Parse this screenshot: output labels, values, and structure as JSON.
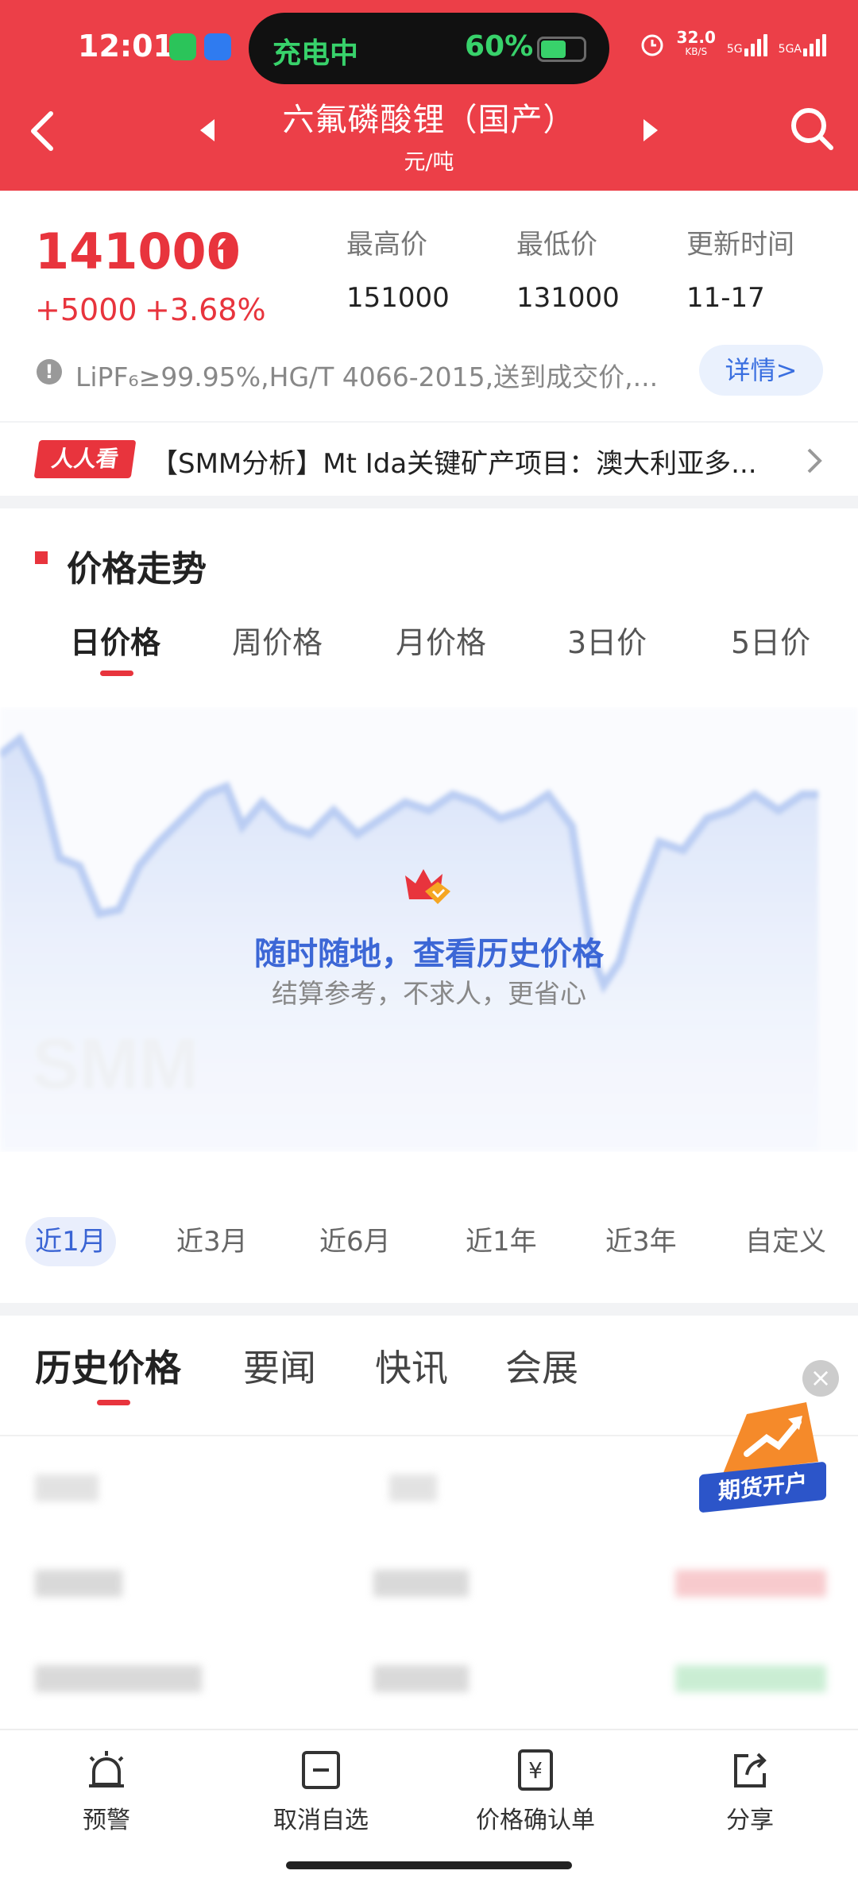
{
  "status_bar": {
    "time": "12:01",
    "charging_label": "充电中",
    "battery_percent": "60%",
    "battery_level": 0.6,
    "net_speed": "32.0",
    "net_unit": "KB/S",
    "network_type": "5G",
    "sim2_label": "5GA"
  },
  "header": {
    "title": "六氟磷酸锂（国产）",
    "unit": "元/吨",
    "bg_color": "#ec3f48"
  },
  "price": {
    "current": "141000",
    "change_abs": "+5000",
    "change_pct": "+3.68%",
    "high_label": "最高价",
    "high_value": "151000",
    "low_label": "最低价",
    "low_value": "131000",
    "updated_label": "更新时间",
    "updated_value": "11-17",
    "note": "LiPF₆≥99.95%,HG/T 4066-2015,送到成交价,...",
    "detail_button": "详情>"
  },
  "news": {
    "tag": "人人看",
    "text": "【SMM分析】Mt Ida关键矿产项目：澳大利亚多..."
  },
  "trend": {
    "title": "价格走势",
    "period_tabs": [
      "日价格",
      "周价格",
      "月价格",
      "3日价",
      "5日价"
    ],
    "overlay_main": "随时随地，查看历史价格",
    "overlay_sub": "结算参考，不求人，更省心",
    "range_tabs": [
      "近1月",
      "近3月",
      "近6月",
      "近1年",
      "近3年",
      "自定义"
    ]
  },
  "history": {
    "tabs": [
      "历史价格",
      "要闻",
      "快讯",
      "会展"
    ],
    "ad_label": "期货开户"
  },
  "bottom_nav": {
    "items": [
      "预警",
      "取消自选",
      "价格确认单",
      "分享"
    ]
  }
}
